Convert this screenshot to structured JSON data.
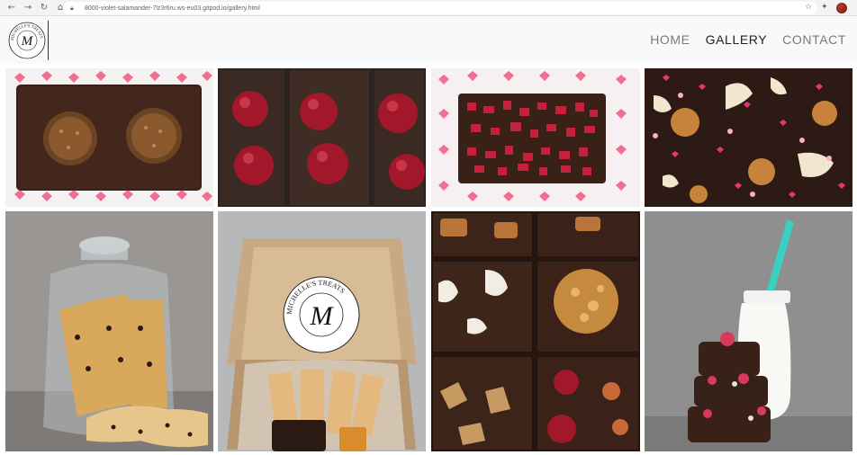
{
  "browser": {
    "url": "8000-violet-salamander-7lz3r6ru.ws-eu03.gitpod.io/gallery.html",
    "icons": [
      "back-icon",
      "forward-icon",
      "reload-icon",
      "home-icon",
      "lock-icon",
      "star-icon",
      "extensions-icon",
      "profile-avatar"
    ]
  },
  "site": {
    "logo": {
      "letter": "M",
      "ring_text": "MICHELLE'S TREATS"
    },
    "nav": [
      {
        "label": "HOME",
        "active": false
      },
      {
        "label": "GALLERY",
        "active": true
      },
      {
        "label": "CONTACT",
        "active": false
      }
    ]
  },
  "gallery": {
    "items": [
      {
        "subject": "brownie with hazelnut chocolates on heart pattern"
      },
      {
        "subject": "brownies with cherries"
      },
      {
        "subject": "brownie with raspberry pieces on heart pattern"
      },
      {
        "subject": "brownie with white chocolate and sprinkles"
      },
      {
        "subject": "biscotti in glass jar"
      },
      {
        "subject": "gift box with Michelle's Treats label"
      },
      {
        "subject": "assorted brownie squares"
      },
      {
        "subject": "brownie stack with milk bottle"
      }
    ],
    "box_label": {
      "letter": "M",
      "ring_text": "MICHELLE'S TREATS"
    }
  },
  "colors": {
    "brownie": "#3a2118",
    "heart": "#f05a7e",
    "cherry": "#a3172a",
    "nav_active": "#222222",
    "nav_inactive": "#7a7a7a"
  }
}
